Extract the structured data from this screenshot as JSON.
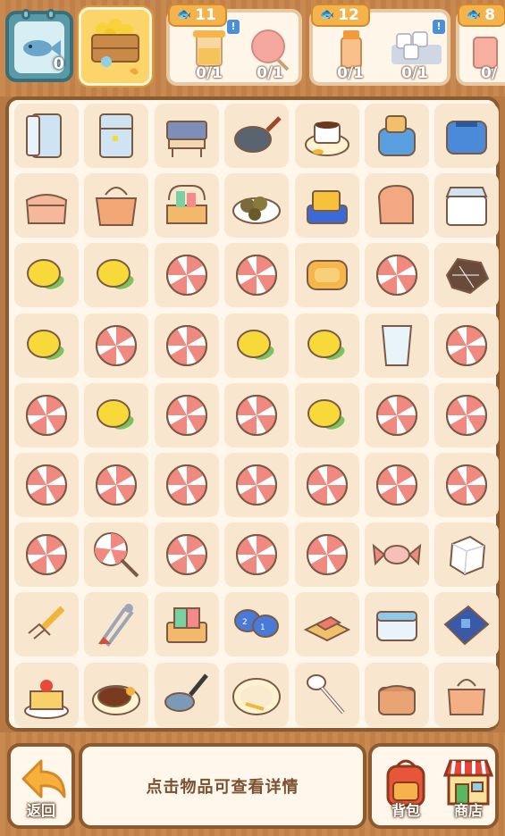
{
  "top": {
    "fish_count": "0",
    "orders": [
      {
        "reward": "11",
        "slots": [
          {
            "item": "juice-cup",
            "progress": "0/1"
          },
          {
            "item": "lollipop",
            "progress": "0/1"
          }
        ]
      },
      {
        "reward": "12",
        "slots": [
          {
            "item": "juice-bottle",
            "progress": "0/1"
          },
          {
            "item": "ice-cubes",
            "progress": "0/1"
          }
        ]
      },
      {
        "reward": "8",
        "slots": [
          {
            "item": "juice-bottle",
            "progress": "0/"
          }
        ]
      }
    ]
  },
  "board": {
    "rows": [
      [
        "fridge-open",
        "fridge",
        "grill",
        "frying-pan",
        "coffee-cup",
        "toaster-bread",
        "toaster"
      ],
      [
        "pink-bag",
        "handbag",
        "dish-rack",
        "rotten-food",
        "butter-dish",
        "purse",
        "storage-box"
      ],
      [
        "lemon",
        "lemon",
        "candy",
        "candy",
        "toast",
        "candy",
        "rotten-meat"
      ],
      [
        "lemon",
        "candy",
        "candy",
        "lemon",
        "lemon",
        "glass",
        "candy"
      ],
      [
        "candy",
        "lemon",
        "candy",
        "candy",
        "lemon",
        "candy",
        "candy"
      ],
      [
        "candy",
        "candy",
        "candy",
        "candy",
        "candy",
        "candy",
        "candy"
      ],
      [
        "candy",
        "lollipop",
        "candy",
        "candy",
        "candy",
        "wrapped-candy",
        "sugar-cube"
      ],
      [
        "fork-tool",
        "tongs",
        "napkin-box",
        "measuring-cups",
        "book-tray",
        "container",
        "circuit-board"
      ],
      [
        "cake",
        "steak-plate",
        "ladle-pan",
        "plate-spoon",
        "spoon",
        "shoulder-bag",
        "tote-bag"
      ]
    ]
  },
  "bottom": {
    "back_label": "返回",
    "hint": "点击物品可查看详情",
    "backpack_label": "背包",
    "shop_label": "商店"
  },
  "colors": {
    "frame": "#8b5a2e",
    "panel": "#fff7ec",
    "cell": "#f9e6cf",
    "accent": "#f3b44d"
  }
}
